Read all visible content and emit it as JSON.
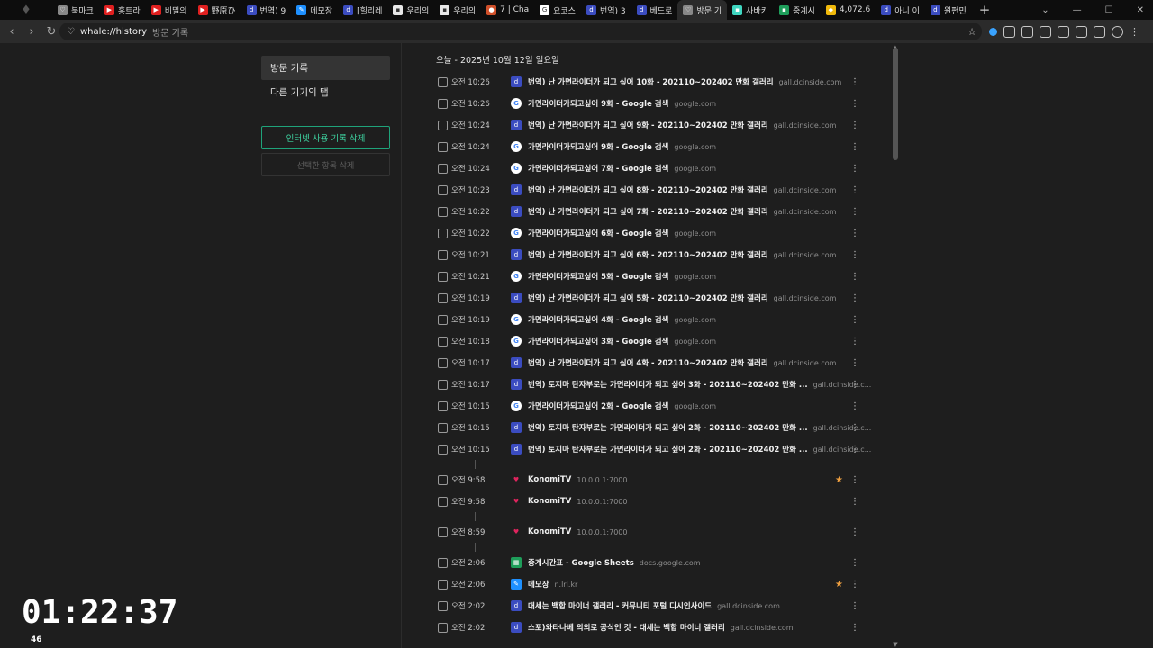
{
  "tabs": [
    {
      "label": "북마크",
      "color": "#888888",
      "glyph": "♡"
    },
    {
      "label": "홍트라",
      "color": "#e02020",
      "glyph": "▶"
    },
    {
      "label": "비밀의",
      "color": "#e02020",
      "glyph": "▶"
    },
    {
      "label": "野原ひ",
      "color": "#e02020",
      "glyph": "▶"
    },
    {
      "label": "번역) 9",
      "color": "#3b4cc0",
      "glyph": "d"
    },
    {
      "label": "메모장",
      "color": "#1e90ff",
      "glyph": "✎"
    },
    {
      "label": "[힐리레",
      "color": "#3b4cc0",
      "glyph": "d"
    },
    {
      "label": "우리의",
      "color": "#e8e8e8",
      "glyph": "▪"
    },
    {
      "label": "우리의",
      "color": "#e8e8e8",
      "glyph": "▪"
    },
    {
      "label": "7 | Cha",
      "color": "#d0502a",
      "glyph": "●"
    },
    {
      "label": "요코스",
      "color": "#ffffff",
      "glyph": "G"
    },
    {
      "label": "번역) 3",
      "color": "#3b4cc0",
      "glyph": "d"
    },
    {
      "label": "베드로",
      "color": "#3b4cc0",
      "glyph": "d"
    },
    {
      "label": "방문 기",
      "color": "#888888",
      "glyph": "♡"
    },
    {
      "label": "사바키",
      "color": "#3fd6c0",
      "glyph": "▪"
    },
    {
      "label": "중계시",
      "color": "#1e9e5a",
      "glyph": "▪"
    },
    {
      "label": "4,072.6",
      "color": "#f0b90b",
      "glyph": "◆"
    },
    {
      "label": "아니 이",
      "color": "#3b4cc0",
      "glyph": "d"
    },
    {
      "label": "원펀민",
      "color": "#3b4cc0",
      "glyph": "d"
    }
  ],
  "active_tab_index": 13,
  "address": {
    "url": "whale://history",
    "page_name": "방문 기록"
  },
  "sidebar": {
    "items": [
      "방문 기록",
      "다른 기기의 탭"
    ],
    "clear_button": "인터넷 사용 기록 삭제",
    "delete_selected_button": "선택한 항목 삭제"
  },
  "day_header": "오늘 - 2025년 10월 12일 일요일",
  "history": [
    {
      "time": "오전 10:26",
      "title": "번역) 난 가면라이더가 되고 싶어 10화 - 202110~202402 만화 갤러리",
      "domain": "gall.dcinside.com",
      "icon": "dc"
    },
    {
      "time": "오전 10:26",
      "title": "가면라이더가되고싶어 9화 - Google 검색",
      "domain": "google.com",
      "icon": "google"
    },
    {
      "time": "오전 10:24",
      "title": "번역) 난 가면라이더가 되고 싶어 9화 - 202110~202402 만화 갤러리",
      "domain": "gall.dcinside.com",
      "icon": "dc"
    },
    {
      "time": "오전 10:24",
      "title": "가면라이더가되고싶어 9화 - Google 검색",
      "domain": "google.com",
      "icon": "google"
    },
    {
      "time": "오전 10:24",
      "title": "가면라이더가되고싶어 7화 - Google 검색",
      "domain": "google.com",
      "icon": "google"
    },
    {
      "time": "오전 10:23",
      "title": "번역) 난 가면라이더가 되고 싶어 8화 - 202110~202402 만화 갤러리",
      "domain": "gall.dcinside.com",
      "icon": "dc"
    },
    {
      "time": "오전 10:22",
      "title": "번역) 난 가면라이더가 되고 싶어 7화 - 202110~202402 만화 갤러리",
      "domain": "gall.dcinside.com",
      "icon": "dc"
    },
    {
      "time": "오전 10:22",
      "title": "가면라이더가되고싶어 6화 - Google 검색",
      "domain": "google.com",
      "icon": "google"
    },
    {
      "time": "오전 10:21",
      "title": "번역) 난 가면라이더가 되고 싶어 6화 - 202110~202402 만화 갤러리",
      "domain": "gall.dcinside.com",
      "icon": "dc"
    },
    {
      "time": "오전 10:21",
      "title": "가면라이더가되고싶어 5화 - Google 검색",
      "domain": "google.com",
      "icon": "google"
    },
    {
      "time": "오전 10:19",
      "title": "번역) 난 가면라이더가 되고 싶어 5화 - 202110~202402 만화 갤러리",
      "domain": "gall.dcinside.com",
      "icon": "dc"
    },
    {
      "time": "오전 10:19",
      "title": "가면라이더가되고싶어 4화 - Google 검색",
      "domain": "google.com",
      "icon": "google"
    },
    {
      "time": "오전 10:18",
      "title": "가면라이더가되고싶어 3화 - Google 검색",
      "domain": "google.com",
      "icon": "google"
    },
    {
      "time": "오전 10:17",
      "title": "번역) 난 가면라이더가 되고 싶어 4화 - 202110~202402 만화 갤러리",
      "domain": "gall.dcinside.com",
      "icon": "dc"
    },
    {
      "time": "오전 10:17",
      "title": "번역) 토지마 탄자부로는 가면라이더가 되고 싶어 3화 - 202110~202402 만화 ...",
      "domain": "gall.dcinside.c...",
      "icon": "dc"
    },
    {
      "time": "오전 10:15",
      "title": "가면라이더가되고싶어 2화 - Google 검색",
      "domain": "google.com",
      "icon": "google"
    },
    {
      "time": "오전 10:15",
      "title": "번역) 토지마 탄자부로는 가면라이더가 되고 싶어 2화 - 202110~202402 만화 ...",
      "domain": "gall.dcinside.c...",
      "icon": "dc"
    },
    {
      "time": "오전 10:15",
      "title": "번역) 토지마 탄자부로는 가면라이더가 되고 싶어 2화 - 202110~202402 만화 ...",
      "domain": "gall.dcinside.c...",
      "icon": "dc"
    },
    {
      "separator": true
    },
    {
      "time": "오전 9:58",
      "title": "KonomiTV",
      "domain": "10.0.0.1:7000",
      "icon": "konomi",
      "starred": true
    },
    {
      "time": "오전 9:58",
      "title": "KonomiTV",
      "domain": "10.0.0.1:7000",
      "icon": "konomi"
    },
    {
      "separator": true
    },
    {
      "time": "오전 8:59",
      "title": "KonomiTV",
      "domain": "10.0.0.1:7000",
      "icon": "konomi"
    },
    {
      "separator": true
    },
    {
      "time": "오전 2:06",
      "title": "중계시간표 - Google Sheets",
      "domain": "docs.google.com",
      "icon": "sheets"
    },
    {
      "time": "오전 2:06",
      "title": "메모장",
      "domain": "n.lrl.kr",
      "icon": "memo",
      "starred": true
    },
    {
      "time": "오전 2:02",
      "title": "대세는 백합 마이너 갤러리 - 커뮤니티 포털 디시인사이드",
      "domain": "gall.dcinside.com",
      "icon": "dc"
    },
    {
      "time": "오전 2:02",
      "title": "스포)와타나베 의외로 공식인 것 - 대세는 백합 마이너 갤러리",
      "domain": "gall.dcinside.com",
      "icon": "dc"
    }
  ],
  "icon_styles": {
    "dc": {
      "color": "#3b4cc0",
      "glyph": "d"
    },
    "google": {
      "color": "#ffffff",
      "glyph": "G"
    },
    "konomi": {
      "color": "#1e1e1e",
      "glyph": "♥"
    },
    "sheets": {
      "color": "#1e9e5a",
      "glyph": "▦"
    },
    "memo": {
      "color": "#1e90ff",
      "glyph": "✎"
    }
  },
  "overlay": {
    "timer": "01:22:37",
    "counter": "46"
  }
}
